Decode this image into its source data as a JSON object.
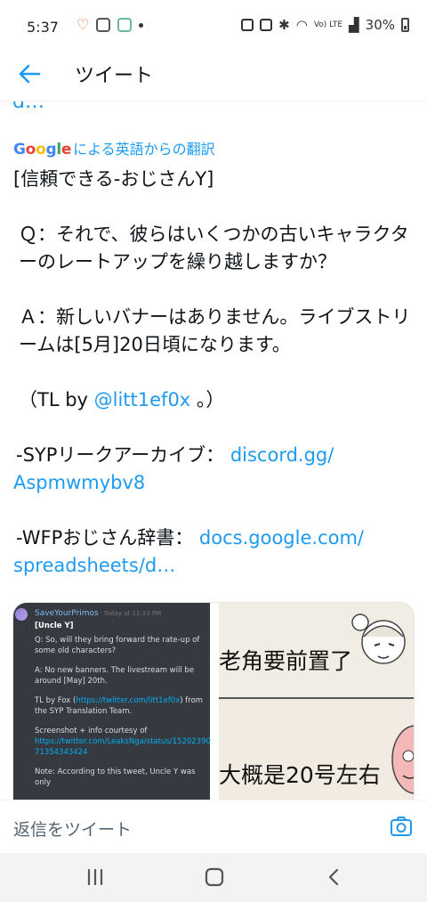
{
  "status_bar": {
    "time": "5:37",
    "battery": "30%",
    "network_label": "Vo) LTE"
  },
  "header": {
    "title": "ツイート"
  },
  "tweet": {
    "cut_text": "d…",
    "translation": {
      "google_letters": [
        "G",
        "o",
        "o",
        "g",
        "l",
        "e"
      ],
      "label": "による英語からの翻訳"
    },
    "lines": {
      "l1": "[信頼できる-おじさんY]",
      "l2": "Ｑ：それで、彼らはいくつかの古いキャラクターのレートアップを繰り越しますか？",
      "l3": "Ａ：新しいバナーはありません。ライブストリームは[5月]20日頃になります。",
      "l4_pre": "（TL by ",
      "l4_link": "@litt1ef0x",
      "l4_post": " 。）",
      "l5_pre": "-SYPリークアーカイブ：",
      "l5_link_a": "discord.gg/",
      "l5_link_b": "Aspmwmybv8",
      "l6_pre": "-WFPおじさん辞書：",
      "l6_link_a": "docs.google.com/",
      "l6_link_b": "spreadsheets/d…"
    }
  },
  "media": {
    "discord": {
      "username": "SaveYourPrimos",
      "timestamp": "Today at 11:33 PM",
      "heading": "[Uncle Y]",
      "q": "Q: So, will they bring forward the rate-up of some old characters?",
      "a": "A: No new banners. The livestream will be around [May] 20th.",
      "tl_pre": "TL by Fox (",
      "tl_link": "https://twitter.com/litt1ef0x",
      "tl_post": ") from the SYP Translation Team.",
      "courtesy": "Screenshot + info courtesy of",
      "courtesy_link": "https://twitter.com/LeaksNga/status/1520239071354343424",
      "note": "Note: According to this tweet, Uncle Y was only"
    },
    "manga": {
      "caption1": "老角要前置了",
      "caption2": "大概是20号左右"
    }
  },
  "reply": {
    "placeholder": "返信をツイート"
  },
  "colors": {
    "accent": "#1d9bf0",
    "discord_bg": "#36393f"
  },
  "icons": [
    "back-arrow-icon",
    "camera-icon",
    "recent-apps-icon",
    "home-icon",
    "nav-back-icon"
  ]
}
